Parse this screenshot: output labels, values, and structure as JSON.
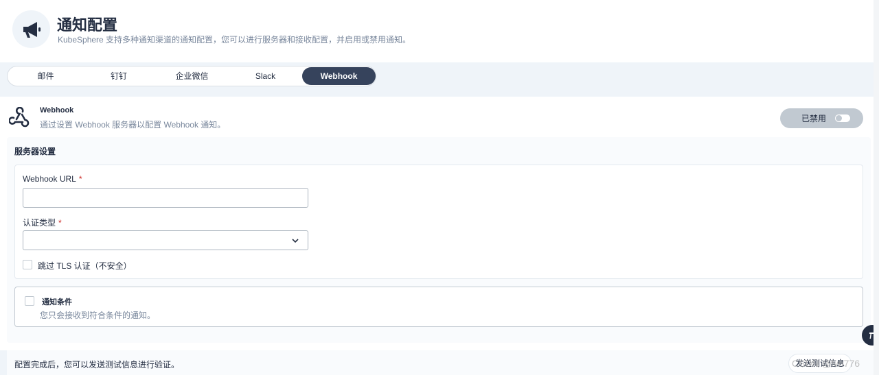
{
  "header": {
    "title": "通知配置",
    "description": "KubeSphere 支持多种通知渠道的通知配置，您可以进行服务器和接收配置，并启用或禁用通知。"
  },
  "tabs": [
    {
      "label": "邮件",
      "active": false
    },
    {
      "label": "钉钉",
      "active": false
    },
    {
      "label": "企业微信",
      "active": false
    },
    {
      "label": "Slack",
      "active": false
    },
    {
      "label": "Webhook",
      "active": true
    }
  ],
  "webhook": {
    "title": "Webhook",
    "description": "通过设置 Webhook 服务器以配置 Webhook 通知。",
    "status_label": "已禁用"
  },
  "server": {
    "title": "服务器设置",
    "url_label": "Webhook URL",
    "url_value": "",
    "auth_label": "认证类型",
    "auth_value": "",
    "required_mark": "*",
    "skip_tls_label": "跳过 TLS 认证（不安全）",
    "skip_tls_checked": false
  },
  "conditions": {
    "title": "通知条件",
    "description": "您只会接收到符合条件的通知。",
    "checked": false
  },
  "footer": {
    "text": "配置完成后，您可以发送测试信息进行验证。",
    "send_button": "发送测试信息"
  },
  "watermark": "CSDN @lvn776",
  "colors": {
    "accent_dark": "#36435c",
    "text": "#242e42",
    "muted": "#79879c",
    "required": "#ca2621",
    "background": "#eff4f9"
  }
}
